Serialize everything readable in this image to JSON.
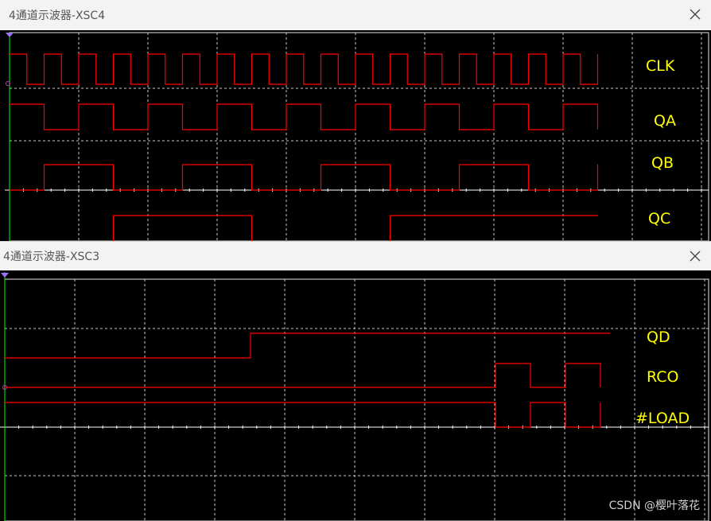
{
  "windows": [
    {
      "title": "4通道示波器-XSC4",
      "channels": [
        {
          "label": "CLK"
        },
        {
          "label": "QA"
        },
        {
          "label": "QB"
        },
        {
          "label": "QC"
        }
      ]
    },
    {
      "title": "4通道示波器-XSC3",
      "channels": [
        {
          "label": "QD"
        },
        {
          "label": "RCO"
        },
        {
          "label": "#LOAD"
        }
      ]
    }
  ],
  "watermark": "CSDN @樱叶落花",
  "colors": {
    "trace": "#ff0000",
    "label": "#ffff00",
    "grid": "#c8c8c8",
    "screen": "#000000",
    "cursor": "#00ff00"
  }
}
